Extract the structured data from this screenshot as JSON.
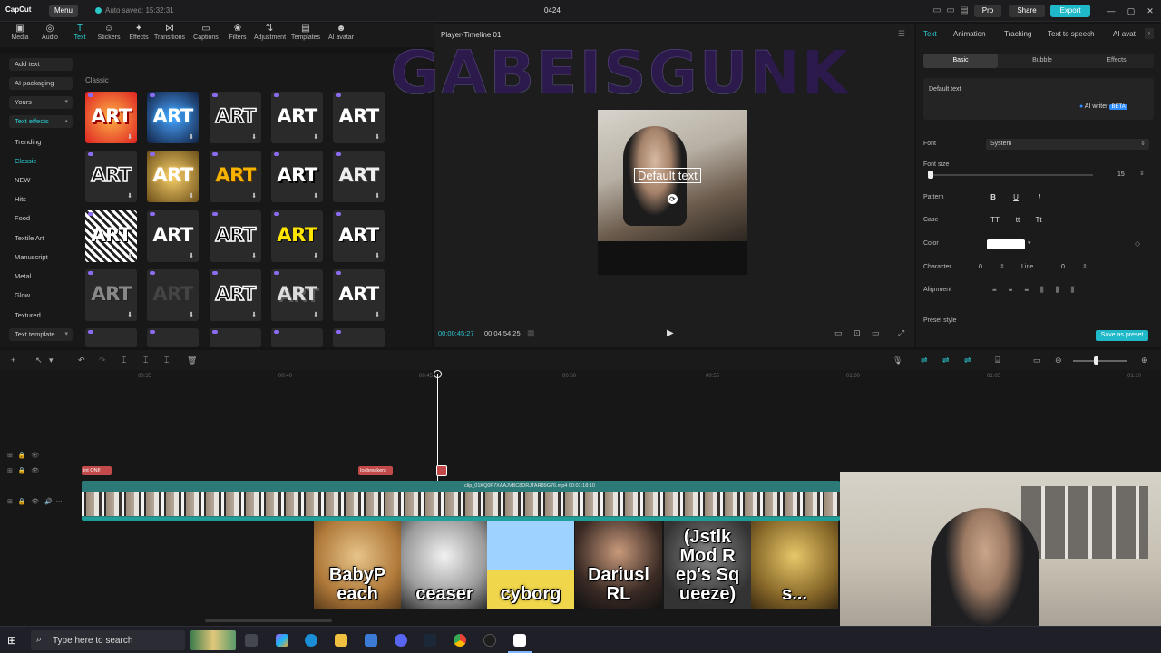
{
  "titlebar": {
    "app": "CapCut",
    "menu": "Menu",
    "autosave": "Auto saved: 15:32:31",
    "project": "0424",
    "pro": "Pro",
    "share": "Share",
    "export": "Export"
  },
  "toolbar": {
    "tools": [
      "Media",
      "Audio",
      "Text",
      "Stickers",
      "Effects",
      "Transitions",
      "Captions",
      "Filters",
      "Adjustment",
      "Templates",
      "AI avatar"
    ],
    "active": "Text"
  },
  "leftnav": {
    "items": [
      "Add text",
      "AI packaging",
      "Yours",
      "Text effects",
      "Trending",
      "Classic",
      "NEW",
      "Hits",
      "Food",
      "Textile Art",
      "Manuscript",
      "Metal",
      "Glow",
      "Textured",
      "Text template"
    ]
  },
  "assets": {
    "section": "Classic",
    "tile_label": "ART"
  },
  "player": {
    "title": "Player-Timeline 01",
    "overlay_big": "GABEISGUNK",
    "overlay_small": "Default text",
    "time_current": "00:00:45:27",
    "time_total": "00:04:54:25"
  },
  "inspector": {
    "tabs": [
      "Text",
      "Animation",
      "Tracking",
      "Text to speech",
      "AI avat"
    ],
    "subtabs": [
      "Basic",
      "Bubble",
      "Effects"
    ],
    "text_value": "Default text",
    "ai_writer": "AI writer",
    "ai_beta": "BETA",
    "labels": {
      "font": "Font",
      "font_size": "Font size",
      "pattern": "Pattern",
      "case": "Case",
      "color": "Color",
      "character": "Character",
      "line": "Line",
      "alignment": "Alignment",
      "preset": "Preset style"
    },
    "font_value": "System",
    "font_size_value": "15",
    "character_value": "0",
    "line_value": "0",
    "pattern_buttons": [
      "B",
      "U",
      "I"
    ],
    "case_buttons": [
      "TT",
      "tt",
      "Tt"
    ],
    "save_preset": "Save as preset"
  },
  "timeline": {
    "ticks": [
      "00:35",
      "00:40",
      "00:45",
      "00:50",
      "00:55",
      "01:00",
      "01:05",
      "01:10"
    ],
    "clips_red": [
      "int ONI!",
      "Icebreakers",
      ""
    ],
    "main_clip_label": "clip_01KQ0P7XAAJVBC8DRJTAR89G76.mp4  00:01:18:10"
  },
  "reactions": {
    "captions": [
      "BabyP each",
      "ceaser",
      "cyborg",
      "Dariusl RL",
      "(Jstlk Mod R ep's Sq ueeze)",
      "s..."
    ]
  },
  "taskbar": {
    "search_placeholder": "Type here to search"
  }
}
